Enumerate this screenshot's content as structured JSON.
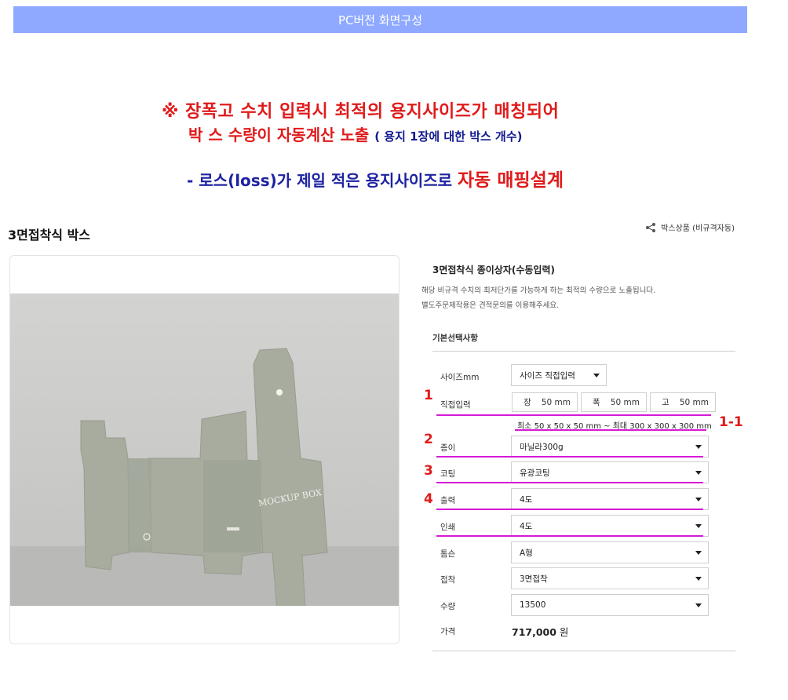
{
  "header": {
    "title": "PC버전 화면구성"
  },
  "notice": {
    "line1": "※  장폭고 수치 입력시 최적의 용지사이즈가  매칭되어",
    "line2_main": "박 스 수량이 자동계산 노출 ",
    "line2_sub": "( 용지 1장에 대한 박스 개수)",
    "line3_main": "- 로스(loss)가 제일 적은 용지사이즈로 ",
    "line3_highlight": "자동 매핑설계"
  },
  "page": {
    "title": "3면접착식 박스",
    "share_label": "박스상품 (비규격자동)"
  },
  "image": {
    "box_text": "MOCKUP BOX"
  },
  "panel": {
    "title": "3면접착식 종이상자(수동입력)",
    "desc1": "해당 비규격 수치의 최저단가를 가능하게 하는 최적의 수량으로 노출됩니다.",
    "desc2": "별도주문제작용은 견적문의를 이용해주세요.",
    "section": "기본선택사항",
    "size_label": "사이즈mm",
    "size_value": "사이즈 직접입력",
    "direct_label": "직접입력",
    "dims": [
      {
        "label": "장",
        "value": "50",
        "unit": "mm"
      },
      {
        "label": "폭",
        "value": "50",
        "unit": "mm"
      },
      {
        "label": "고",
        "value": "50",
        "unit": "mm"
      }
    ],
    "range": "최소 50 x 50 x 50 mm ~ 최대 300 x 300 x 300 mm",
    "rows": [
      {
        "label": "종이",
        "value": "마닐라300g"
      },
      {
        "label": "코팅",
        "value": "유광코팅"
      },
      {
        "label": "출력",
        "value": "4도"
      },
      {
        "label": "인쇄",
        "value": "4도"
      },
      {
        "label": "톰슨",
        "value": "A형"
      },
      {
        "label": "접착",
        "value": "3면접착"
      },
      {
        "label": "수량",
        "value": "13500"
      }
    ],
    "price_label": "가격",
    "price_value": "717,000",
    "price_unit": "원"
  },
  "markers": {
    "m1": "1",
    "m1_1": "1-1",
    "m2": "2",
    "m3": "3",
    "m4": "4"
  },
  "colors": {
    "header_bg": "#8ea9ff",
    "annotation_red": "#e01b1b",
    "annotation_blue": "#1d22a0",
    "underline": "#d61ad6"
  }
}
